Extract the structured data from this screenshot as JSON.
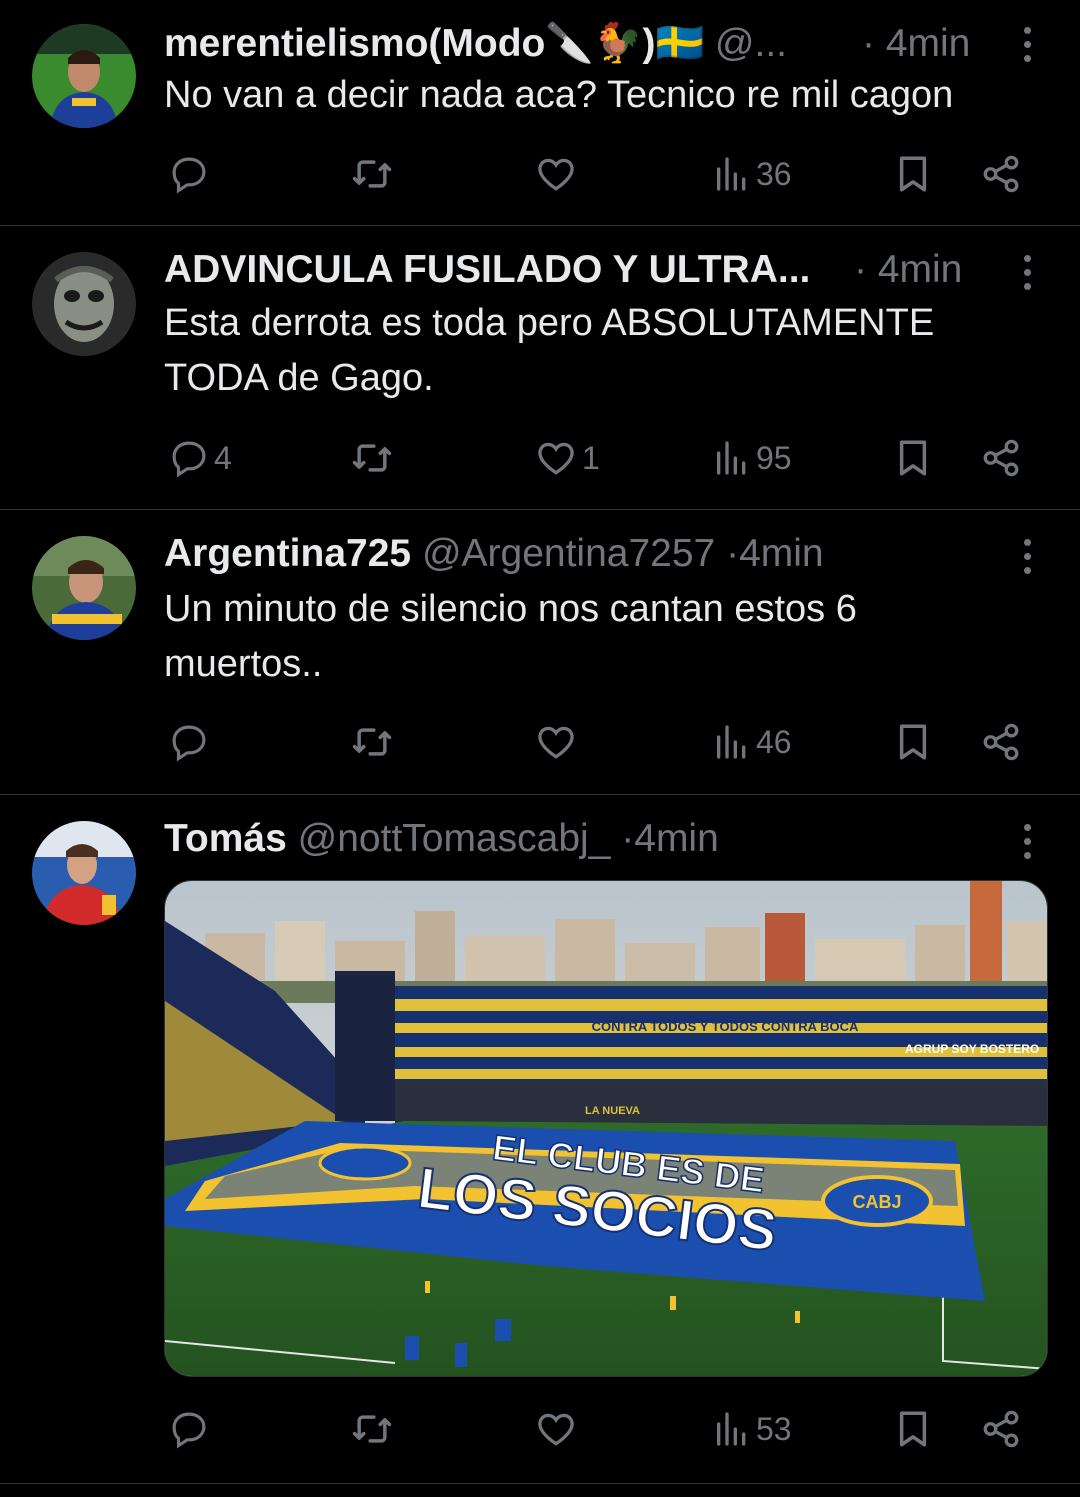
{
  "tweets": [
    {
      "name": "merentielismo(Modo🔪🐓)🇸🇪",
      "handle": "@...",
      "time": "4min",
      "text": "No van a decir nada aca? Tecnico re mil cagon",
      "replies": "",
      "likes": "",
      "views": "36"
    },
    {
      "name": "ADVINCULA FUSILADO Y ULTRA...",
      "handle": "",
      "time": "4min",
      "text": "Esta derrota es toda pero ABSOLUTAMENTE TODA de Gago.",
      "replies": "4",
      "likes": "1",
      "views": "95"
    },
    {
      "name": "Argentina725",
      "handle": "@Argentina7257",
      "time": "4min",
      "text": "Un minuto de silencio nos cantan estos 6 muertos..",
      "replies": "",
      "likes": "",
      "views": "46"
    },
    {
      "name": "Tomás",
      "handle": "@nottTomascabj_",
      "time": "4min",
      "text": "",
      "replies": "",
      "likes": "",
      "views": "53",
      "media": {
        "flag_line1": "EL CLUB ES DE",
        "flag_line2": "LOS SOCIOS",
        "banner_1": "CONTRA TODOS Y TODOS CONTRA BOCA",
        "banner_2": "AGRUP SOY BOSTERO",
        "banner_3": "LA NUEVA",
        "crest_text": "CABJ"
      }
    }
  ],
  "colors": {
    "background": "#000000",
    "muted": "#71767b",
    "text": "#e7e9ea",
    "divider": "#2f3336",
    "boca_blue": "#1a4fb0",
    "boca_gold": "#f2c230"
  }
}
